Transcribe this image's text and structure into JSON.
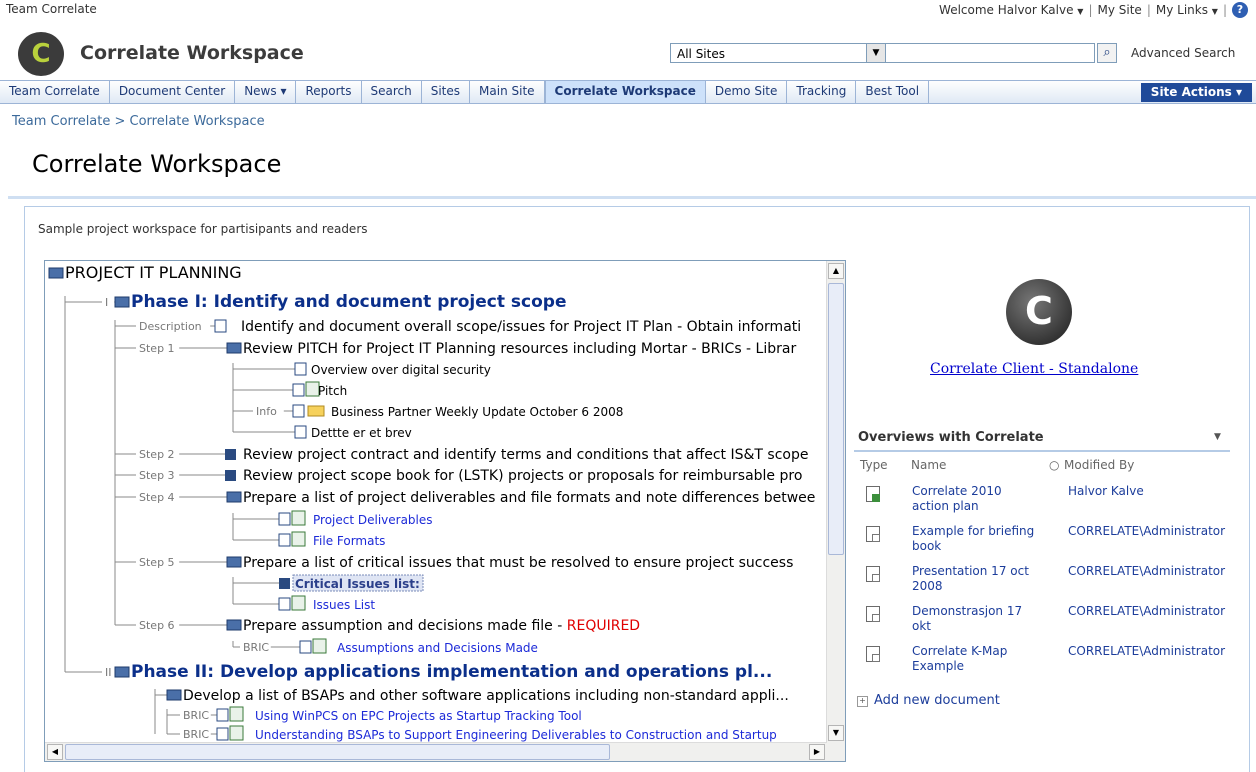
{
  "topbar": {
    "site_name": "Team Correlate",
    "welcome": "Welcome Halvor Kalve",
    "my_site": "My Site",
    "my_links": "My Links",
    "separator": "|",
    "help_icon": "?"
  },
  "header": {
    "logo_letter": "C",
    "title": "Correlate Workspace",
    "scope_value": "All Sites",
    "search_placeholder": "",
    "advanced_search": "Advanced Search"
  },
  "nav": {
    "tabs": [
      {
        "label": "Team Correlate"
      },
      {
        "label": "Document Center"
      },
      {
        "label": "News"
      },
      {
        "label": "Reports"
      },
      {
        "label": "Search"
      },
      {
        "label": "Sites"
      },
      {
        "label": "Main Site"
      },
      {
        "label": "Correlate Workspace",
        "selected": true
      },
      {
        "label": "Demo Site"
      },
      {
        "label": "Tracking"
      },
      {
        "label": "Best Tool"
      }
    ],
    "site_actions": "Site Actions ▾"
  },
  "breadcrumb": "Team Correlate > Correlate Workspace",
  "page_title": "Correlate Workspace",
  "description": "Sample project workspace for partisipants and readers",
  "tree": {
    "nodes": [
      {
        "text": "PROJECT IT PLANNING",
        "style": "root"
      },
      {
        "prefix": "I",
        "text": "Phase I: Identify and document project scope",
        "style": "phase"
      },
      {
        "prefix": "Description",
        "text": "Identify and document overall scope/issues for Project IT Plan - Obtain informati",
        "style": "node"
      },
      {
        "prefix": "Step 1",
        "text": "Review PITCH for Project IT Planning resources including Mortar - BRICs - Librar",
        "style": "node"
      },
      {
        "text": "Overview over digital security",
        "style": "leaf"
      },
      {
        "text": "Pitch",
        "style": "leaf"
      },
      {
        "prefix": "Info",
        "text": "Business Partner Weekly Update   October 6  2008",
        "style": "leaf"
      },
      {
        "text": "Dettte er et brev",
        "style": "leaf"
      },
      {
        "prefix": "Step 2",
        "text": "Review project contract and identify terms and conditions that affect IS&T scope",
        "style": "node"
      },
      {
        "prefix": "Step 3",
        "text": "Review project scope book for (LSTK) projects or proposals for reimbursable pro",
        "style": "node"
      },
      {
        "prefix": "Step 4",
        "text": "Prepare a list of project deliverables and file formats and note differences betwee",
        "style": "node"
      },
      {
        "text": "Project Deliverables",
        "style": "link"
      },
      {
        "text": "File Formats",
        "style": "link"
      },
      {
        "prefix": "Step 5",
        "text": "Prepare a list of critical issues that must be resolved to ensure project success",
        "style": "node"
      },
      {
        "text": "Critical Issues list:",
        "style": "selected"
      },
      {
        "text": "Issues List",
        "style": "link"
      },
      {
        "prefix": "Step 6",
        "text": "Prepare assumption and decisions made file - ",
        "required": "REQUIRED",
        "style": "node"
      },
      {
        "prefix": "BRIC",
        "text": "Assumptions and Decisions Made",
        "style": "link"
      },
      {
        "prefix": "II",
        "text": "Phase II: Develop applications implementation and operations pl...",
        "style": "phase"
      },
      {
        "text": "Develop a list of BSAPs and other software applications including non-standard appli...",
        "style": "node"
      },
      {
        "prefix": "BRIC",
        "text": "Using WinPCS on EPC Projects as Startup Tracking Tool",
        "style": "link"
      },
      {
        "prefix": "BRIC",
        "text": "Understanding BSAPs to Support Engineering Deliverables to Construction and Startup",
        "style": "link"
      }
    ]
  },
  "client": {
    "logo_letter": "C",
    "link": "Correlate Client - Standalone"
  },
  "overviews": {
    "title": "Overviews with Correlate",
    "col_type": "Type",
    "col_name": "Name",
    "col_modified": "Modified By",
    "rows": [
      {
        "name": "Correlate 2010 action plan",
        "by": "Halvor Kalve",
        "icon": "excel-doc-icon"
      },
      {
        "name": "Example for briefing book",
        "by": "CORRELATE\\Administrator",
        "icon": "correlate-doc-icon"
      },
      {
        "name": "Presentation 17 oct 2008",
        "by": "CORRELATE\\Administrator",
        "icon": "correlate-doc-icon"
      },
      {
        "name": "Demonstrasjon 17 okt",
        "by": "CORRELATE\\Administrator",
        "icon": "correlate-doc-icon"
      },
      {
        "name": "Correlate K-Map Example",
        "by": "CORRELATE\\Administrator",
        "icon": "correlate-doc-icon"
      }
    ],
    "add_new": "Add new document"
  }
}
